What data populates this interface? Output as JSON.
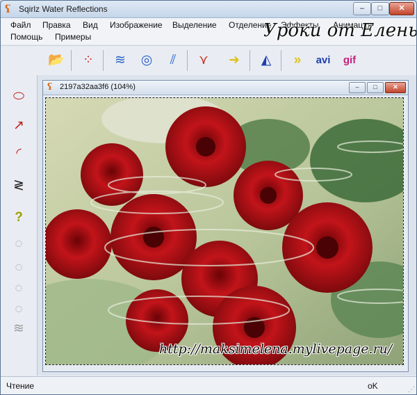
{
  "app": {
    "title": "Sqirlz Water Reflections",
    "icon": "squirrel-app-icon",
    "window_buttons": {
      "minimize": "–",
      "maximize": "□",
      "close": "✕"
    }
  },
  "menu": {
    "items": [
      "Файл",
      "Правка",
      "Вид",
      "Изображение",
      "Выделение",
      "Отделение",
      "Эффекты",
      "Анимация",
      "Помощь",
      "Примеры"
    ]
  },
  "watermark": {
    "header": "Уроки от Елены",
    "url": "http://maksimelena.mylivepage.ru/"
  },
  "toolbar": {
    "items": [
      {
        "icon": "open-folder-icon",
        "glyph": "📂",
        "color": "#2f8a1f"
      },
      {
        "icon": "color-dots-icon",
        "glyph": "⁘",
        "color": "#d02828"
      },
      {
        "icon": "wave-lines-icon",
        "glyph": "≋",
        "color": "#2b62c9"
      },
      {
        "icon": "ripple-circles-icon",
        "glyph": "◎",
        "color": "#2b62c9"
      },
      {
        "icon": "rain-drops-icon",
        "glyph": "⫽",
        "color": "#2b62c9"
      },
      {
        "icon": "fountain-icon",
        "glyph": "⋎",
        "color": "#c93a2b"
      },
      {
        "icon": "arrow-right-icon",
        "glyph": "➜",
        "color": "#e0c21a"
      },
      {
        "icon": "triangle-ruler-icon",
        "glyph": "◭",
        "color": "#1f3fb0"
      },
      {
        "icon": "animation-frames-icon",
        "glyph": "»",
        "color": "#e0c21a"
      },
      {
        "icon": "avi-icon",
        "label": "avi",
        "color": "#1f3fb0"
      },
      {
        "icon": "gif-icon",
        "label": "gif",
        "color": "#c91f7a"
      }
    ]
  },
  "lefttools": [
    {
      "icon": "ellipse-icon",
      "glyph": "⬭",
      "color": "#c02020"
    },
    {
      "icon": "direction-arrow-icon",
      "glyph": "↗",
      "color": "#c02020"
    },
    {
      "icon": "arc-icon",
      "glyph": "◜",
      "color": "#c02020"
    },
    {
      "icon": "zigzag-icon",
      "glyph": "≷",
      "color": "#222"
    },
    {
      "icon": "shape-help-icon",
      "glyph": "?",
      "color": "#a0a000"
    },
    {
      "icon": "disabled-shape-1-icon",
      "glyph": "◌",
      "color": "#9a9a9a"
    },
    {
      "icon": "disabled-shape-2-icon",
      "glyph": "◌",
      "color": "#9a9a9a"
    },
    {
      "icon": "disabled-shape-3-icon",
      "glyph": "◌",
      "color": "#9a9a9a"
    },
    {
      "icon": "disabled-shape-4-icon",
      "glyph": "◌",
      "color": "#9a9a9a"
    },
    {
      "icon": "disabled-waves-icon",
      "glyph": "≋",
      "color": "#9a9a9a"
    }
  ],
  "document": {
    "title": "2197a32aa3f6  (104%)",
    "buttons": {
      "minimize": "–",
      "maximize": "□",
      "close": "✕"
    }
  },
  "status": {
    "left": "Чтение",
    "right": "оK"
  }
}
